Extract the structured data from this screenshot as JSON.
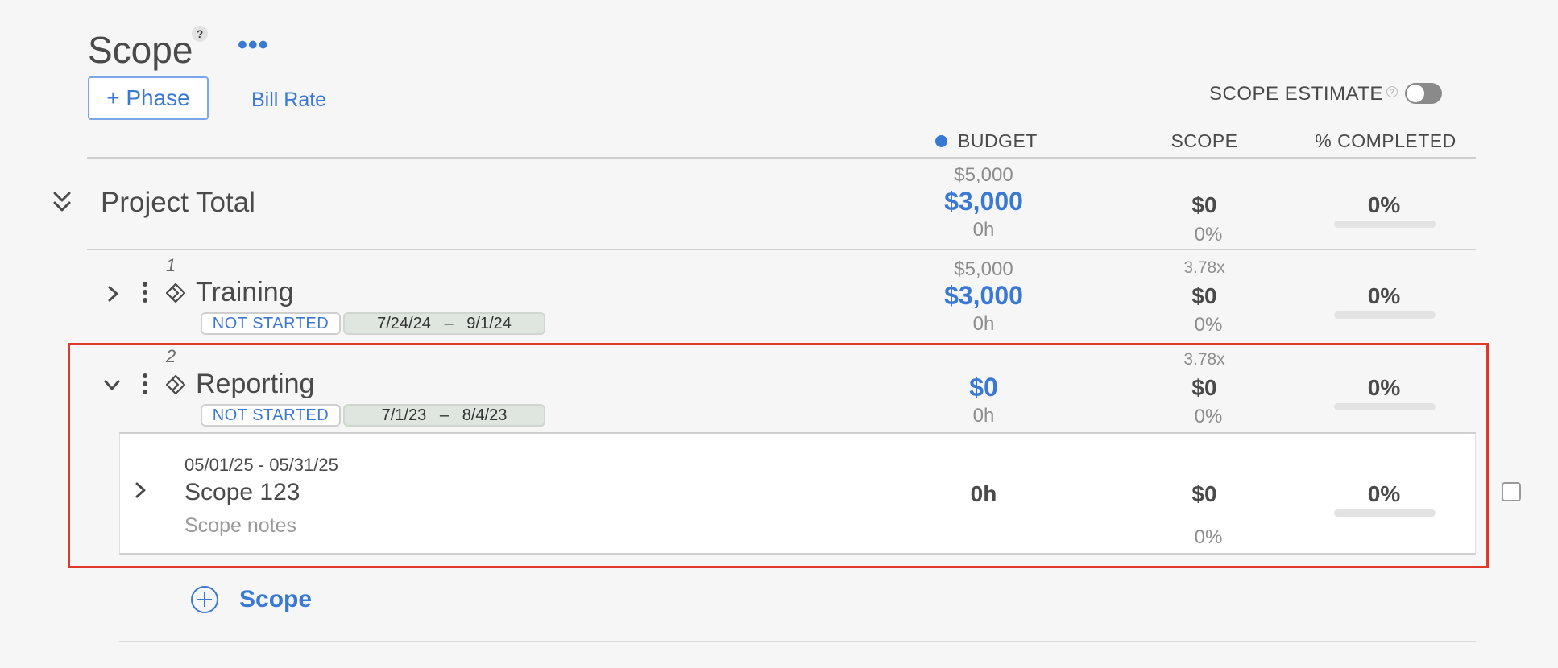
{
  "header": {
    "title": "Scope",
    "help_glyph": "?",
    "more_glyph": "•••",
    "add_phase_label": "+ Phase",
    "bill_rate_label": "Bill Rate",
    "scope_estimate_label": "SCOPE ESTIMATE",
    "scope_estimate_help": "?",
    "scope_estimate_toggle": false
  },
  "columns": {
    "budget": "BUDGET",
    "scope": "SCOPE",
    "completed": "% COMPLETED"
  },
  "project_total": {
    "label": "Project Total",
    "budget_total": "$5,000",
    "budget_remaining": "$3,000",
    "budget_hours": "0h",
    "scope_amount": "$0",
    "scope_percent": "0%",
    "completed": "0%",
    "completed_fraction": 0
  },
  "phases": [
    {
      "number": "1",
      "name": "Training",
      "status": "NOT STARTED",
      "dates": "7/24/24   –   9/1/24",
      "budget_total": "$5,000",
      "budget_remaining": "$3,000",
      "budget_hours": "0h",
      "multiplier": "3.78x",
      "scope_amount": "$0",
      "scope_percent": "0%",
      "completed": "0%",
      "completed_fraction": 0
    },
    {
      "number": "2",
      "name": "Reporting",
      "status": "NOT STARTED",
      "dates": "7/1/23   –   8/4/23",
      "budget_remaining": "$0",
      "budget_hours": "0h",
      "multiplier": "3.78x",
      "scope_amount": "$0",
      "scope_percent": "0%",
      "completed": "0%",
      "completed_fraction": 0
    }
  ],
  "scope_item": {
    "dates": "05/01/25 - 05/31/25",
    "name": "Scope 123",
    "notes": "Scope notes",
    "hours": "0h",
    "scope_amount": "$0",
    "scope_percent": "0%",
    "completed": "0%",
    "completed_fraction": 0
  },
  "add_scope_label": "Scope",
  "colors": {
    "accent": "#3a78d6",
    "highlight_border": "#e0392c",
    "date_tag_bg": "#dfe6df"
  },
  "icons": {
    "collapse_all": "double-chevron-down-icon",
    "expand": "chevron-right-icon",
    "collapse": "chevron-down-icon",
    "menu": "vertical-dots-icon",
    "phase": "diamond-icon",
    "add": "plus-circle-icon"
  }
}
